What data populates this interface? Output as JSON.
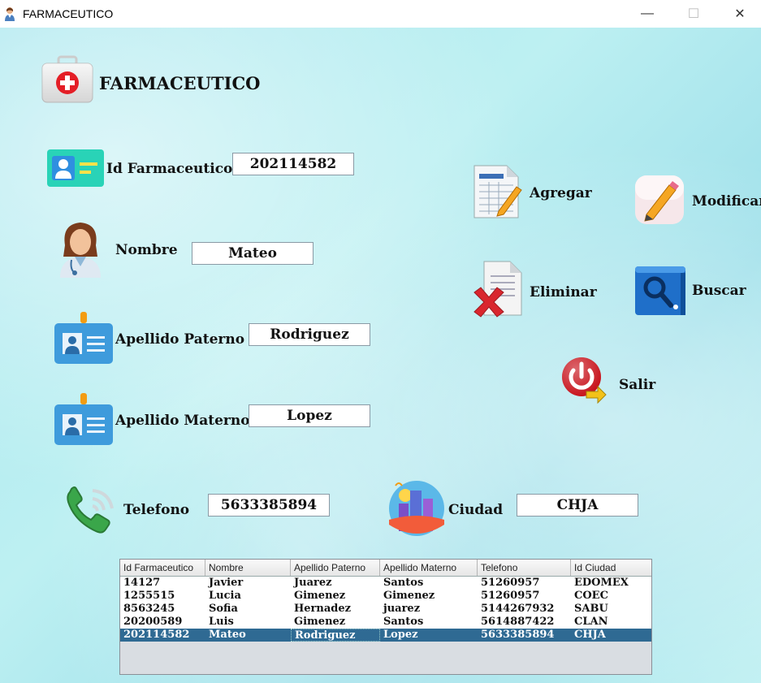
{
  "window": {
    "title": "FARMACEUTICO",
    "min_glyph": "—",
    "max_glyph": "☐",
    "close_glyph": "✕"
  },
  "header": {
    "title": "FARMACEUTICO",
    "icon": "first-aid-kit-icon"
  },
  "form": {
    "id": {
      "label": "Id Farmaceutico",
      "value": "202114582",
      "icon": "id-card-icon"
    },
    "nombre": {
      "label": "Nombre",
      "value": "Mateo",
      "icon": "doctor-avatar-icon"
    },
    "apellido_paterno": {
      "label": "Apellido Paterno",
      "value": "Rodriguez",
      "icon": "badge-icon"
    },
    "apellido_materno": {
      "label": "Apellido Materno",
      "value": "Lopez",
      "icon": "badge-icon"
    },
    "telefono": {
      "label": "Telefono",
      "value": "5633385894",
      "icon": "phone-icon"
    },
    "ciudad": {
      "label": "Ciudad",
      "value": "CHJA",
      "icon": "city-icon"
    }
  },
  "actions": {
    "agregar": "Agregar",
    "modificar": "Modificar",
    "eliminar": "Eliminar",
    "buscar": "Buscar",
    "salir": "Salir"
  },
  "table": {
    "columns": [
      "Id Farmaceutico",
      "Nombre",
      "Apellido Paterno",
      "Apellido Materno",
      "Telefono",
      "Id Ciudad"
    ],
    "rows": [
      [
        "14127",
        "Javier",
        "Juarez",
        "Santos",
        "51260957",
        "EDOMEX"
      ],
      [
        "1255515",
        "Lucia",
        "Gimenez",
        "Gimenez",
        "51260957",
        "COEC"
      ],
      [
        "8563245",
        "Sofia",
        "Hernadez",
        "juarez",
        "5144267932",
        "SABU"
      ],
      [
        "20200589",
        "Luis",
        "Gimenez",
        "Santos",
        "5614887422",
        "CLAN"
      ],
      [
        "202114582",
        "Mateo",
        "Rodriguez",
        "Lopez",
        "5633385894",
        "CHJA"
      ]
    ],
    "selected_row": 4
  },
  "colors": {
    "selected_row": "#2f6a93",
    "background": "#a8e7ee"
  }
}
